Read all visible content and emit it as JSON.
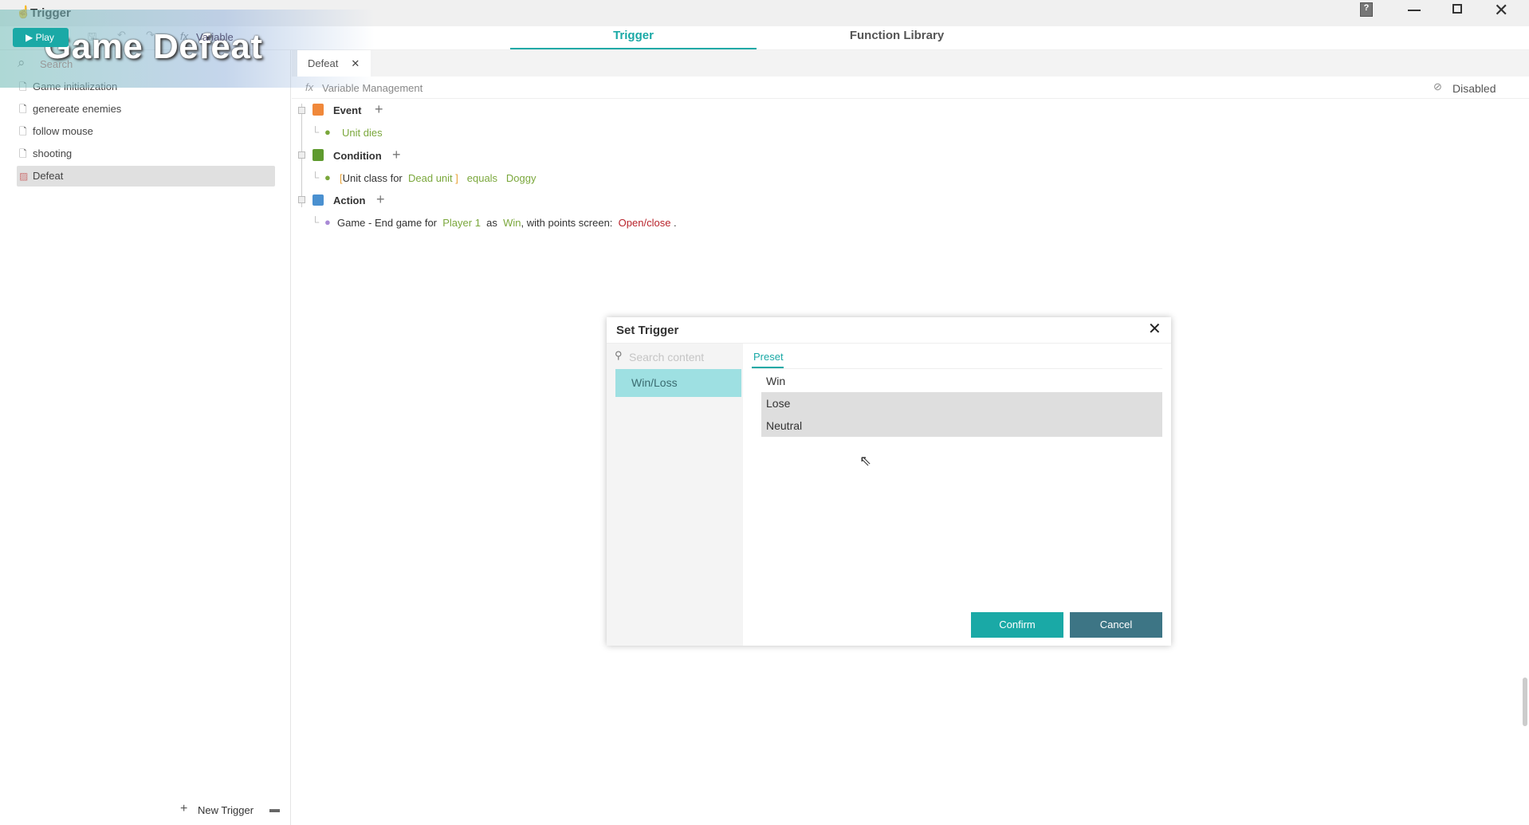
{
  "window": {
    "title": "Trigger",
    "banner": "Game Defeat"
  },
  "toolbar": {
    "play": "Play",
    "variable": "Variable"
  },
  "tabs": [
    {
      "label": "Trigger"
    },
    {
      "label": "Function Library"
    }
  ],
  "sidebar": {
    "search_placeholder": "Search",
    "items": [
      {
        "label": "Game initialization"
      },
      {
        "label": "genereate enemies"
      },
      {
        "label": "follow mouse"
      },
      {
        "label": "shooting"
      },
      {
        "label": "Defeat"
      }
    ],
    "new_trigger": "New Trigger"
  },
  "editor": {
    "tab": "Defeat",
    "variable_management": "Variable Management",
    "status": "Disabled",
    "event": {
      "label": "Event",
      "item": "Unit dies"
    },
    "condition": {
      "label": "Condition",
      "parts": [
        "[",
        "Unit class for",
        "Dead unit",
        "]",
        "equals",
        "Doggy"
      ]
    },
    "action": {
      "label": "Action",
      "parts": [
        "Game - End game for",
        "Player 1",
        "as",
        "Win",
        ", with points screen:",
        "Open/close",
        "."
      ]
    }
  },
  "dialog": {
    "title": "Set Trigger",
    "search_placeholder": "Search content",
    "categories": [
      {
        "label": "Win/Loss"
      }
    ],
    "tab": "Preset",
    "options": [
      "Win",
      "Lose",
      "Neutral"
    ],
    "confirm": "Confirm",
    "cancel": "Cancel"
  },
  "colors": {
    "accent": "#1aa9a6",
    "cancel": "#3d7585",
    "category_sel": "#9ee0e2"
  }
}
